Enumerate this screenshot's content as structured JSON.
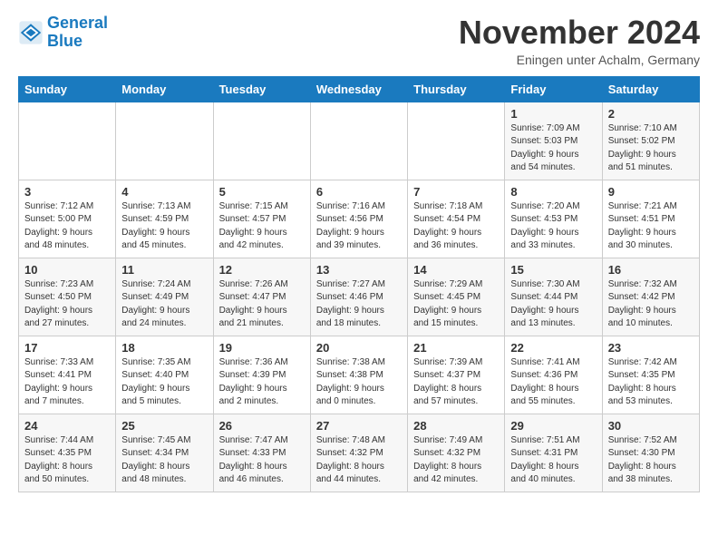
{
  "header": {
    "title": "November 2024",
    "location": "Eningen unter Achalm, Germany",
    "logo_line1": "General",
    "logo_line2": "Blue"
  },
  "weekdays": [
    "Sunday",
    "Monday",
    "Tuesday",
    "Wednesday",
    "Thursday",
    "Friday",
    "Saturday"
  ],
  "weeks": [
    [
      {
        "day": "",
        "info": ""
      },
      {
        "day": "",
        "info": ""
      },
      {
        "day": "",
        "info": ""
      },
      {
        "day": "",
        "info": ""
      },
      {
        "day": "",
        "info": ""
      },
      {
        "day": "1",
        "info": "Sunrise: 7:09 AM\nSunset: 5:03 PM\nDaylight: 9 hours\nand 54 minutes."
      },
      {
        "day": "2",
        "info": "Sunrise: 7:10 AM\nSunset: 5:02 PM\nDaylight: 9 hours\nand 51 minutes."
      }
    ],
    [
      {
        "day": "3",
        "info": "Sunrise: 7:12 AM\nSunset: 5:00 PM\nDaylight: 9 hours\nand 48 minutes."
      },
      {
        "day": "4",
        "info": "Sunrise: 7:13 AM\nSunset: 4:59 PM\nDaylight: 9 hours\nand 45 minutes."
      },
      {
        "day": "5",
        "info": "Sunrise: 7:15 AM\nSunset: 4:57 PM\nDaylight: 9 hours\nand 42 minutes."
      },
      {
        "day": "6",
        "info": "Sunrise: 7:16 AM\nSunset: 4:56 PM\nDaylight: 9 hours\nand 39 minutes."
      },
      {
        "day": "7",
        "info": "Sunrise: 7:18 AM\nSunset: 4:54 PM\nDaylight: 9 hours\nand 36 minutes."
      },
      {
        "day": "8",
        "info": "Sunrise: 7:20 AM\nSunset: 4:53 PM\nDaylight: 9 hours\nand 33 minutes."
      },
      {
        "day": "9",
        "info": "Sunrise: 7:21 AM\nSunset: 4:51 PM\nDaylight: 9 hours\nand 30 minutes."
      }
    ],
    [
      {
        "day": "10",
        "info": "Sunrise: 7:23 AM\nSunset: 4:50 PM\nDaylight: 9 hours\nand 27 minutes."
      },
      {
        "day": "11",
        "info": "Sunrise: 7:24 AM\nSunset: 4:49 PM\nDaylight: 9 hours\nand 24 minutes."
      },
      {
        "day": "12",
        "info": "Sunrise: 7:26 AM\nSunset: 4:47 PM\nDaylight: 9 hours\nand 21 minutes."
      },
      {
        "day": "13",
        "info": "Sunrise: 7:27 AM\nSunset: 4:46 PM\nDaylight: 9 hours\nand 18 minutes."
      },
      {
        "day": "14",
        "info": "Sunrise: 7:29 AM\nSunset: 4:45 PM\nDaylight: 9 hours\nand 15 minutes."
      },
      {
        "day": "15",
        "info": "Sunrise: 7:30 AM\nSunset: 4:44 PM\nDaylight: 9 hours\nand 13 minutes."
      },
      {
        "day": "16",
        "info": "Sunrise: 7:32 AM\nSunset: 4:42 PM\nDaylight: 9 hours\nand 10 minutes."
      }
    ],
    [
      {
        "day": "17",
        "info": "Sunrise: 7:33 AM\nSunset: 4:41 PM\nDaylight: 9 hours\nand 7 minutes."
      },
      {
        "day": "18",
        "info": "Sunrise: 7:35 AM\nSunset: 4:40 PM\nDaylight: 9 hours\nand 5 minutes."
      },
      {
        "day": "19",
        "info": "Sunrise: 7:36 AM\nSunset: 4:39 PM\nDaylight: 9 hours\nand 2 minutes."
      },
      {
        "day": "20",
        "info": "Sunrise: 7:38 AM\nSunset: 4:38 PM\nDaylight: 9 hours\nand 0 minutes."
      },
      {
        "day": "21",
        "info": "Sunrise: 7:39 AM\nSunset: 4:37 PM\nDaylight: 8 hours\nand 57 minutes."
      },
      {
        "day": "22",
        "info": "Sunrise: 7:41 AM\nSunset: 4:36 PM\nDaylight: 8 hours\nand 55 minutes."
      },
      {
        "day": "23",
        "info": "Sunrise: 7:42 AM\nSunset: 4:35 PM\nDaylight: 8 hours\nand 53 minutes."
      }
    ],
    [
      {
        "day": "24",
        "info": "Sunrise: 7:44 AM\nSunset: 4:35 PM\nDaylight: 8 hours\nand 50 minutes."
      },
      {
        "day": "25",
        "info": "Sunrise: 7:45 AM\nSunset: 4:34 PM\nDaylight: 8 hours\nand 48 minutes."
      },
      {
        "day": "26",
        "info": "Sunrise: 7:47 AM\nSunset: 4:33 PM\nDaylight: 8 hours\nand 46 minutes."
      },
      {
        "day": "27",
        "info": "Sunrise: 7:48 AM\nSunset: 4:32 PM\nDaylight: 8 hours\nand 44 minutes."
      },
      {
        "day": "28",
        "info": "Sunrise: 7:49 AM\nSunset: 4:32 PM\nDaylight: 8 hours\nand 42 minutes."
      },
      {
        "day": "29",
        "info": "Sunrise: 7:51 AM\nSunset: 4:31 PM\nDaylight: 8 hours\nand 40 minutes."
      },
      {
        "day": "30",
        "info": "Sunrise: 7:52 AM\nSunset: 4:30 PM\nDaylight: 8 hours\nand 38 minutes."
      }
    ]
  ]
}
